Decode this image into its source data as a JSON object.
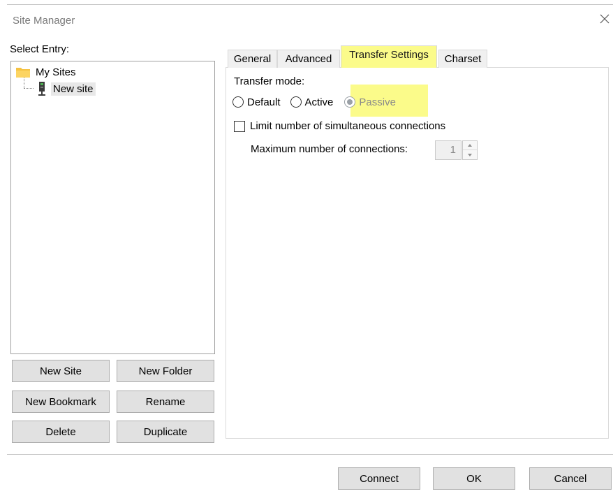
{
  "window": {
    "title": "Site Manager",
    "close_icon": "close-icon"
  },
  "left": {
    "select_entry_label": "Select Entry:",
    "tree": {
      "root": {
        "label": "My Sites",
        "icon": "folder-icon"
      },
      "child": {
        "label": "New site",
        "icon": "server-icon"
      }
    },
    "buttons": {
      "new_site": "New Site",
      "new_folder": "New Folder",
      "new_bookmark": "New Bookmark",
      "rename": "Rename",
      "delete": "Delete",
      "duplicate": "Duplicate"
    }
  },
  "tabs": [
    {
      "label": "General"
    },
    {
      "label": "Advanced"
    },
    {
      "label": "Transfer Settings",
      "active": true
    },
    {
      "label": "Charset"
    }
  ],
  "transfer_settings": {
    "transfer_mode_label": "Transfer mode:",
    "modes": [
      {
        "label": "Default",
        "checked": false
      },
      {
        "label": "Active",
        "checked": false
      },
      {
        "label": "Passive",
        "checked": true
      }
    ],
    "limit_label": "Limit number of simultaneous connections",
    "limit_checked": false,
    "max_connections_label": "Maximum number of connections:",
    "max_connections_value": "1"
  },
  "footer": {
    "connect": "Connect",
    "ok": "OK",
    "cancel": "Cancel"
  },
  "colors": {
    "highlight": "#fbfb8a",
    "button_bg": "#e1e1e1",
    "border": "#adadad"
  }
}
